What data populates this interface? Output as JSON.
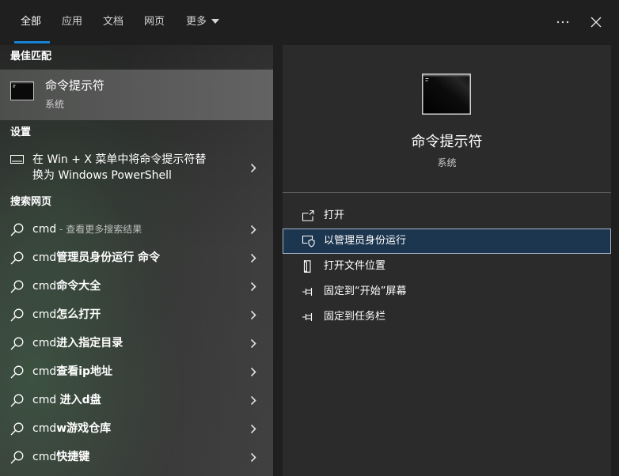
{
  "tabs": [
    {
      "label": "全部",
      "selected": true
    },
    {
      "label": "应用"
    },
    {
      "label": "文档"
    },
    {
      "label": "网页"
    },
    {
      "label": "更多",
      "icon": "chevron-down-icon"
    }
  ],
  "window_controls": {
    "more_icon": "more-options-icon",
    "close_icon": "close-icon"
  },
  "colors": {
    "accent": "#1583d6",
    "best_match_highlight": "#5a5a5a",
    "focus_background": "#1d3650",
    "focus_border": "#a3b5c6",
    "panel_background": "#2b2b2b"
  },
  "best_match": {
    "heading": "最佳匹配",
    "item": {
      "title": "命令提示符",
      "subtitle": "系统",
      "icon": "command-prompt-icon"
    }
  },
  "settings": {
    "heading": "设置",
    "item": {
      "lines": [
        "在 Win + X 菜单中将命令提示符替",
        "换为 Windows PowerShell"
      ],
      "icon": "display-icon"
    }
  },
  "web_results": {
    "heading": "搜索网页",
    "icon": "search-icon",
    "items": [
      {
        "prefix": "cmd",
        "note": " - 查看更多搜索结果"
      },
      {
        "prefix": "cmd",
        "emphasis": "管理员身份运行 命令"
      },
      {
        "prefix": "cmd",
        "emphasis": "命令大全"
      },
      {
        "prefix": "cmd",
        "emphasis": "怎么打开"
      },
      {
        "prefix": "cmd",
        "emphasis": "进入指定目录"
      },
      {
        "prefix": "cmd",
        "emphasis": "查看ip地址"
      },
      {
        "prefix": "cmd ",
        "emphasis": "进入d盘"
      },
      {
        "prefix": "cmd",
        "emphasis": "w游戏仓库"
      },
      {
        "prefix": "cmd",
        "emphasis": "快捷键"
      }
    ]
  },
  "preview": {
    "title": "命令提示符",
    "subtitle": "系统",
    "icon": "command-prompt-icon",
    "actions": [
      {
        "label": "打开",
        "icon": "open-icon"
      },
      {
        "label": "以管理员身份运行",
        "icon": "run-as-admin-icon",
        "focused": true
      },
      {
        "label": "打开文件位置",
        "icon": "file-location-icon"
      },
      {
        "label": "固定到“开始”屏幕",
        "icon": "pin-icon"
      },
      {
        "label": "固定到任务栏",
        "icon": "pin-icon"
      }
    ]
  }
}
